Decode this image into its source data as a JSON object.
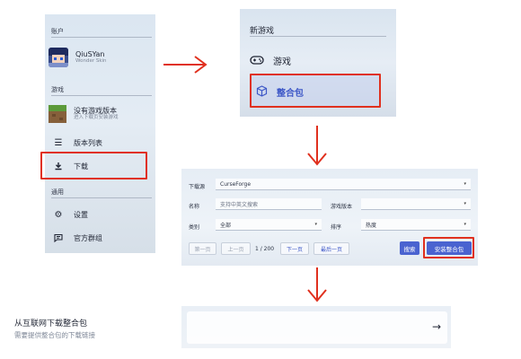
{
  "sidebar": {
    "account_section": "账户",
    "user_name": "QiuSYan",
    "user_subtitle": "Wonder Skin",
    "game_section": "游戏",
    "no_game_title": "没有游戏版本",
    "no_game_subtitle": "进入下载页安装游戏",
    "version_list": "版本列表",
    "download": "下载",
    "general_section": "通用",
    "settings": "设置",
    "community": "官方群组"
  },
  "new_game": {
    "title": "新游戏",
    "game_item": "游戏",
    "modpack_item": "整合包"
  },
  "download_form": {
    "source_label": "下载源",
    "source_value": "CurseForge",
    "name_label": "名称",
    "name_placeholder": "支持中英文搜索",
    "game_version_label": "游戏版本",
    "category_label": "类别",
    "category_value": "全部",
    "sort_label": "排序",
    "sort_value": "热度",
    "first_page": "第一页",
    "prev_page": "上一页",
    "page_indicator": "1 / 200",
    "next_page": "下一页",
    "last_page": "最后一页",
    "search_button": "搜索",
    "install_button": "安装整合包"
  },
  "modpack_card": {
    "title": "从互联网下载整合包",
    "subtitle": "需要提供整合包的下载链接",
    "arrow": "→"
  },
  "colors": {
    "accent": "#3d57c7",
    "highlight_border": "#e0301e",
    "primary_button": "#4a63d0"
  }
}
